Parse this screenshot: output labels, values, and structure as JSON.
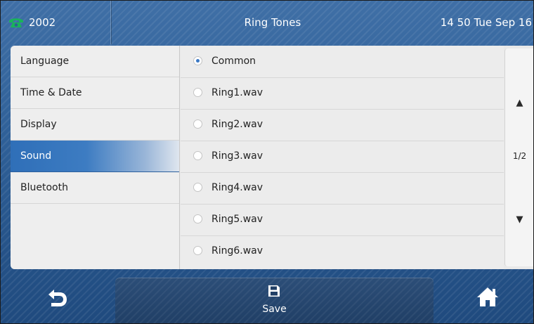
{
  "header": {
    "account": "2002",
    "title": "Ring Tones",
    "datetime": "14 50 Tue Sep 16",
    "account_icon": "phone-icon"
  },
  "menu": {
    "items": [
      {
        "label": "Language"
      },
      {
        "label": "Time & Date"
      },
      {
        "label": "Display"
      },
      {
        "label": "Sound",
        "active": true
      },
      {
        "label": "Bluetooth"
      }
    ]
  },
  "ringtones": {
    "selected": "Common",
    "options": [
      {
        "label": "Common"
      },
      {
        "label": "Ring1.wav"
      },
      {
        "label": "Ring2.wav"
      },
      {
        "label": "Ring3.wav"
      },
      {
        "label": "Ring4.wav"
      },
      {
        "label": "Ring5.wav"
      },
      {
        "label": "Ring6.wav"
      }
    ]
  },
  "scroll": {
    "page_indicator": "1/2",
    "up_glyph": "▲",
    "down_glyph": "▼"
  },
  "softkeys": {
    "back_icon": "back-icon",
    "save_label": "Save",
    "save_icon": "save-icon",
    "home_icon": "home-icon"
  },
  "colors": {
    "accent": "#3a78c4",
    "bar": "#2e5f97",
    "phone_icon": "#19b35a"
  }
}
